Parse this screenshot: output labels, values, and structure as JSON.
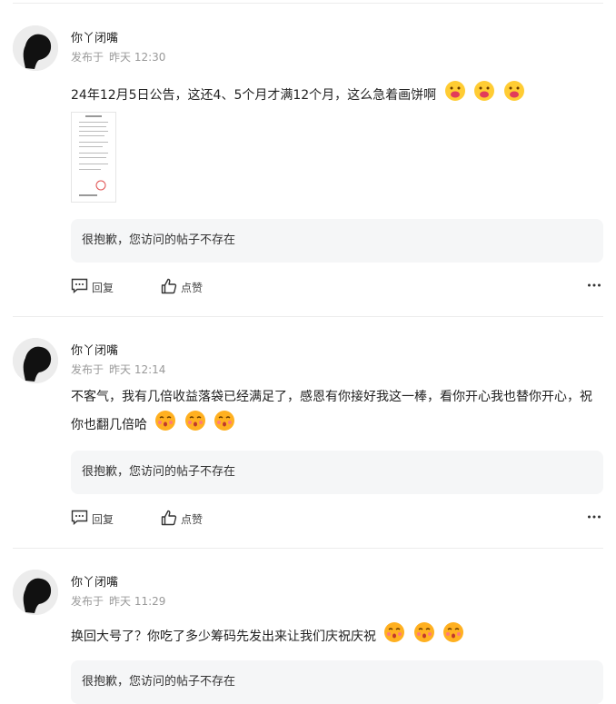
{
  "posts": [
    {
      "author": "你丫闭嘴",
      "published_prefix": "发布于",
      "time": "昨天 12:30",
      "content": "24年12月5日公告，这还4、5个月才满12个月，这么急着画饼啊",
      "emoji": "drooling-face-icon",
      "quote": "很抱歉，您访问的帖子不存在",
      "reply_label": "回复",
      "like_label": "点赞"
    },
    {
      "author": "你丫闭嘴",
      "published_prefix": "发布于",
      "time": "昨天 12:14",
      "content": "不客气，我有几倍收益落袋已经满足了，感恩有你接好我这一棒，看你开心我也替你开心，祝你也翻几倍哈",
      "emoji": "kiss-face-icon",
      "quote": "很抱歉，您访问的帖子不存在",
      "reply_label": "回复",
      "like_label": "点赞"
    },
    {
      "author": "你丫闭嘴",
      "published_prefix": "发布于",
      "time": "昨天 11:29",
      "content": "换回大号了？你吃了多少筹码先发出来让我们庆祝庆祝",
      "emoji": "kiss-face-icon",
      "quote": "很抱歉，您访问的帖子不存在"
    }
  ]
}
